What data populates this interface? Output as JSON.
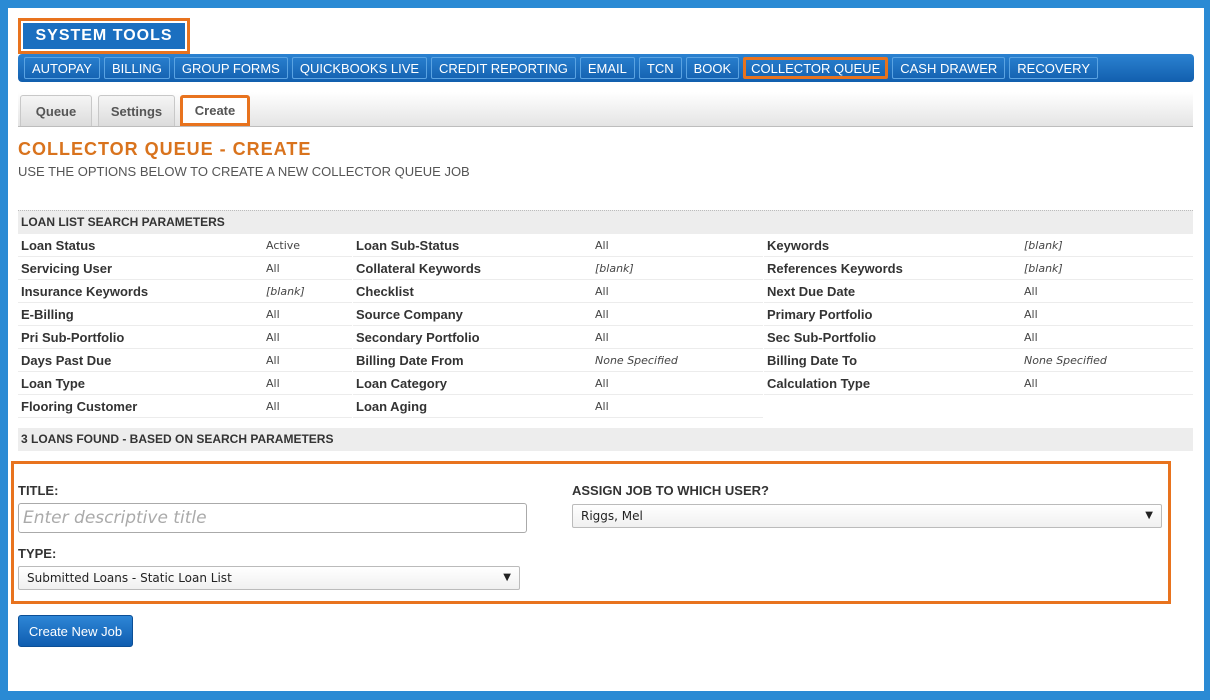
{
  "header": {
    "title": "SYSTEM TOOLS"
  },
  "nav": [
    {
      "label": "AUTOPAY",
      "active": false
    },
    {
      "label": "BILLING",
      "active": false
    },
    {
      "label": "GROUP FORMS",
      "active": false
    },
    {
      "label": "QUICKBOOKS LIVE",
      "active": false
    },
    {
      "label": "CREDIT REPORTING",
      "active": false
    },
    {
      "label": "EMAIL",
      "active": false
    },
    {
      "label": "TCN",
      "active": false
    },
    {
      "label": "BOOK",
      "active": false
    },
    {
      "label": "COLLECTOR QUEUE",
      "active": true
    },
    {
      "label": "CASH DRAWER",
      "active": false
    },
    {
      "label": "RECOVERY",
      "active": false
    }
  ],
  "tabs": [
    {
      "label": "Queue",
      "active": false
    },
    {
      "label": "Settings",
      "active": false
    },
    {
      "label": "Create",
      "active": true
    }
  ],
  "page": {
    "title": "COLLECTOR QUEUE - CREATE",
    "subtitle": "USE THE OPTIONS BELOW TO CREATE A NEW COLLECTOR QUEUE JOB"
  },
  "params": {
    "heading": "LOAN LIST SEARCH PARAMETERS",
    "rows": [
      [
        {
          "label": "Loan Status",
          "value": "Active"
        },
        {
          "label": "Loan Sub-Status",
          "value": "All"
        },
        {
          "label": "Keywords",
          "value": "[blank]"
        }
      ],
      [
        {
          "label": "Servicing User",
          "value": "All"
        },
        {
          "label": "Collateral Keywords",
          "value": "[blank]"
        },
        {
          "label": "References Keywords",
          "value": "[blank]"
        }
      ],
      [
        {
          "label": "Insurance Keywords",
          "value": "[blank]"
        },
        {
          "label": "Checklist",
          "value": "All"
        },
        {
          "label": "Next Due Date",
          "value": "All"
        }
      ],
      [
        {
          "label": "E-Billing",
          "value": "All"
        },
        {
          "label": "Source Company",
          "value": "All"
        },
        {
          "label": "Primary Portfolio",
          "value": "All"
        }
      ],
      [
        {
          "label": "Pri Sub-Portfolio",
          "value": "All"
        },
        {
          "label": "Secondary Portfolio",
          "value": "All"
        },
        {
          "label": "Sec Sub-Portfolio",
          "value": "All"
        }
      ],
      [
        {
          "label": "Days Past Due",
          "value": "All"
        },
        {
          "label": "Billing Date From",
          "value": "None Specified"
        },
        {
          "label": "Billing Date To",
          "value": "None Specified"
        }
      ],
      [
        {
          "label": "Loan Type",
          "value": "All"
        },
        {
          "label": "Loan Category",
          "value": "All"
        },
        {
          "label": "Calculation Type",
          "value": "All"
        }
      ],
      [
        {
          "label": "Flooring Customer",
          "value": "All"
        },
        {
          "label": "Loan Aging",
          "value": "All"
        },
        {
          "label": "",
          "value": ""
        }
      ]
    ],
    "found": "3 LOANS FOUND - BASED ON SEARCH PARAMETERS"
  },
  "form": {
    "title_label": "TITLE:",
    "title_placeholder": "Enter descriptive title",
    "title_value": "",
    "type_label": "TYPE:",
    "type_value": "Submitted Loans - Static Loan List",
    "assign_label": "ASSIGN JOB TO WHICH USER?",
    "assign_value": "Riggs, Mel",
    "submit_label": "Create New Job"
  },
  "colors": {
    "accent": "#e8731e",
    "primary": "#1b6fc0",
    "title": "#d9731d"
  }
}
